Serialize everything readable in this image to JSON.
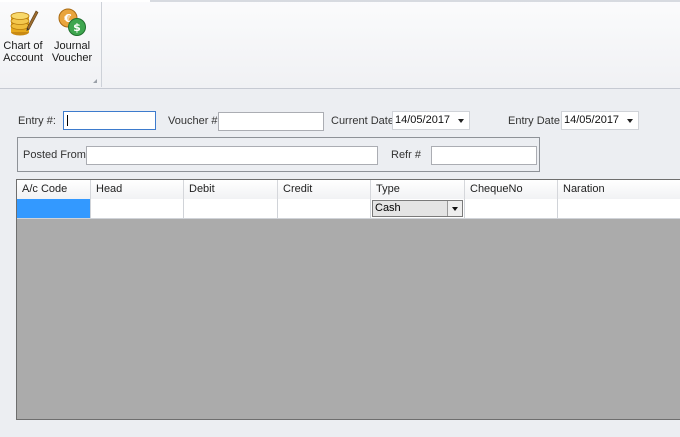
{
  "ribbon": {
    "buttons": [
      {
        "label": "Chart of\nAccount",
        "icon": "coins-pen-icon"
      },
      {
        "label": "Journal\nVoucher",
        "icon": "currency-exchange-icon"
      }
    ]
  },
  "form": {
    "entry_label": "Entry #:",
    "entry_value": "",
    "voucher_label": "Voucher #",
    "voucher_value": "",
    "current_date_label": "Current Date",
    "current_date_value": "14/05/2017",
    "entry_date_label": "Entry Date",
    "entry_date_value": "14/05/2017",
    "posted_from_label": "Posted From",
    "posted_from_value": "",
    "refr_label": "Refr #",
    "refr_value": ""
  },
  "grid": {
    "columns": [
      "A/c Code",
      "Head",
      "Debit",
      "Credit",
      "Type",
      "ChequeNo",
      "Naration"
    ],
    "rows": [
      {
        "ac_code": "",
        "head": "",
        "debit": "",
        "credit": "",
        "type": "Cash",
        "cheque_no": "",
        "naration": ""
      }
    ]
  },
  "colors": {
    "selection": "#3399ff",
    "grid_background": "#ababab",
    "window_background": "#eceef2"
  }
}
